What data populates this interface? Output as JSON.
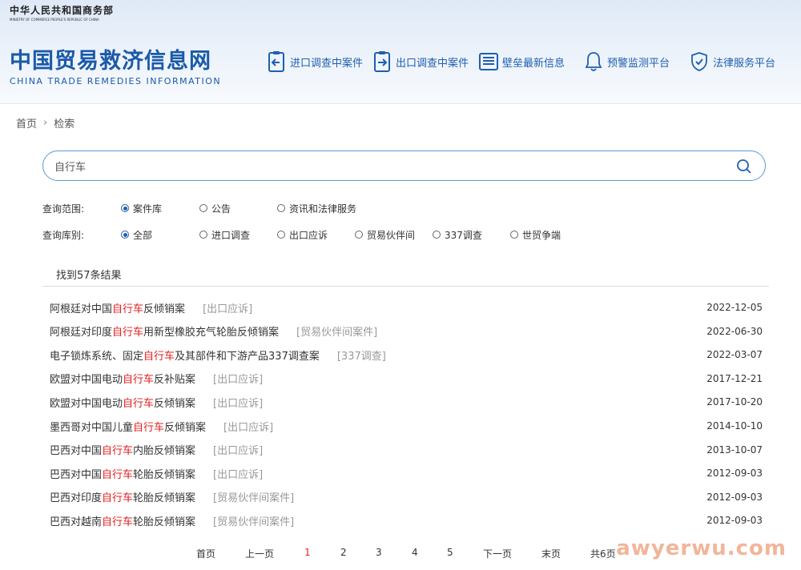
{
  "header": {
    "ministry_cn": "中华人民共和国商务部",
    "ministry_en": "MINISTRY OF COMMERCE PEOPLE'S REPUBLIC OF CHINA",
    "site_title_cn": "中国贸易救济信息网",
    "site_title_en": "CHINA TRADE REMEDIES INFORMATION",
    "nav": [
      {
        "label": "进口调查中案件",
        "icon": "import-case-icon"
      },
      {
        "label": "出口调查中案件",
        "icon": "export-case-icon"
      },
      {
        "label": "壁垒最新信息",
        "icon": "news-icon"
      },
      {
        "label": "预警监测平台",
        "icon": "bell-icon"
      },
      {
        "label": "法律服务平台",
        "icon": "shield-check-icon"
      }
    ]
  },
  "breadcrumb": {
    "home": "首页",
    "current": "检索"
  },
  "search": {
    "value": "自行车",
    "icon": "search-icon"
  },
  "filters": {
    "scope": {
      "label": "查询范围:",
      "options": [
        {
          "label": "案件库",
          "selected": true
        },
        {
          "label": "公告",
          "selected": false
        },
        {
          "label": "资讯和法律服务",
          "selected": false
        }
      ]
    },
    "library": {
      "label": "查询库别:",
      "options": [
        {
          "label": "全部",
          "selected": true
        },
        {
          "label": "进口调查",
          "selected": false
        },
        {
          "label": "出口应诉",
          "selected": false
        },
        {
          "label": "贸易伙伴间",
          "selected": false
        },
        {
          "label": "337调查",
          "selected": false
        },
        {
          "label": "世贸争端",
          "selected": false
        }
      ]
    }
  },
  "results": {
    "count_text": "找到57条结果",
    "highlight": "自行车",
    "items": [
      {
        "pre": "阿根廷对中国",
        "post": "反倾销案",
        "tag": "[出口应诉]",
        "date": "2022-12-05"
      },
      {
        "pre": "阿根廷对印度",
        "post": "用新型橡胶充气轮胎反倾销案",
        "tag": "[贸易伙伴间案件]",
        "date": "2022-06-30"
      },
      {
        "pre": "电子锁炼系统、固定",
        "post": "及其部件和下游产品337调查案",
        "tag": "[337调查]",
        "date": "2022-03-07"
      },
      {
        "pre": "欧盟对中国电动",
        "post": "反补贴案",
        "tag": "[出口应诉]",
        "date": "2017-12-21"
      },
      {
        "pre": "欧盟对中国电动",
        "post": "反倾销案",
        "tag": "[出口应诉]",
        "date": "2017-10-20"
      },
      {
        "pre": "墨西哥对中国儿童",
        "post": "反倾销案",
        "tag": "[出口应诉]",
        "date": "2014-10-10"
      },
      {
        "pre": "巴西对中国",
        "post": "内胎反倾销案",
        "tag": "[出口应诉]",
        "date": "2013-10-07"
      },
      {
        "pre": "巴西对中国",
        "post": "轮胎反倾销案",
        "tag": "[出口应诉]",
        "date": "2012-09-03"
      },
      {
        "pre": "巴西对印度",
        "post": "轮胎反倾销案",
        "tag": "[贸易伙伴间案件]",
        "date": "2012-09-03"
      },
      {
        "pre": "巴西对越南",
        "post": "轮胎反倾销案",
        "tag": "[贸易伙伴间案件]",
        "date": "2012-09-03"
      }
    ]
  },
  "pagination": {
    "first": "首页",
    "prev": "上一页",
    "pages": [
      "1",
      "2",
      "3",
      "4",
      "5"
    ],
    "current": "1",
    "next": "下一页",
    "last": "末页",
    "total": "共6页"
  },
  "watermark": "awyerwu.com",
  "colors": {
    "brand": "#1b5aa8",
    "highlight": "#e02020",
    "tag": "#999999"
  }
}
